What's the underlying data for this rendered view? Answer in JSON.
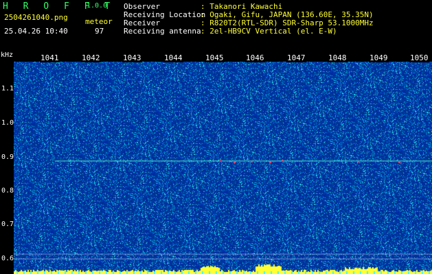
{
  "app": {
    "name": "H R O F F T",
    "version": "1.0.0"
  },
  "file": {
    "name": "2504261040.png",
    "datetime": "25.04.26 10:40"
  },
  "detection": {
    "label": "meteor",
    "count": "97"
  },
  "info": [
    {
      "label": "Observer",
      "value": ": Takanori Kawachi"
    },
    {
      "label": "Receiving Location",
      "value": ": Ogaki, Gifu, JAPAN (136.60E, 35.35N)"
    },
    {
      "label": "Receiver",
      "value": ": R820T2(RTL-SDR) SDR-Sharp 53.1000MHz"
    },
    {
      "label": "Receiving antenna",
      "value": ": 2el-HB9CV Vertical (el. E-W)"
    }
  ],
  "axis": {
    "unit": "kHz",
    "x_ticks": [
      "1041",
      "1042",
      "1043",
      "1044",
      "1045",
      "1046",
      "1047",
      "1048",
      "1049",
      "1050"
    ],
    "y_ticks": [
      "1.1",
      "1.0",
      "0.9",
      "0.8",
      "0.7",
      "0.6"
    ]
  },
  "colors": {
    "background": "#00208c",
    "text": "#ffffff",
    "accent": "#ffff33",
    "title": "#33ff66"
  }
}
